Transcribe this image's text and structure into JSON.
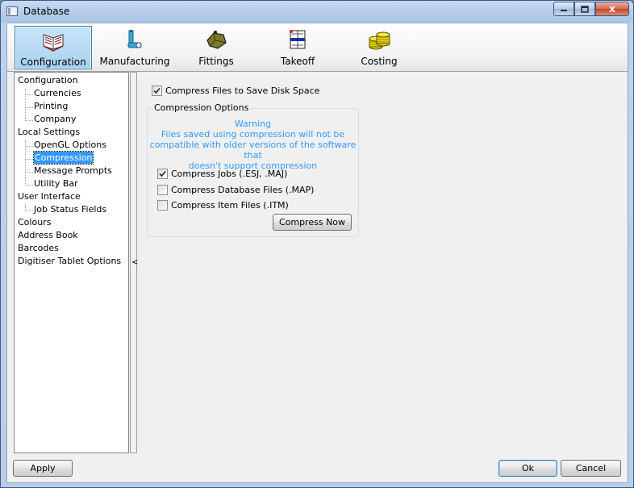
{
  "window": {
    "title": "Database",
    "close_glyph": "x"
  },
  "toolbar": {
    "items": [
      {
        "label": "Configuration",
        "icon": "books-icon",
        "active": true
      },
      {
        "label": "Manufacturing",
        "icon": "machine-icon",
        "active": false
      },
      {
        "label": "Fittings",
        "icon": "fitting-icon",
        "active": false
      },
      {
        "label": "Takeoff",
        "icon": "takeoff-icon",
        "active": false
      },
      {
        "label": "Costing",
        "icon": "coins-icon",
        "active": false
      }
    ]
  },
  "tree": {
    "items": [
      {
        "label": "Configuration",
        "level": 0
      },
      {
        "label": "Currencies",
        "level": 1
      },
      {
        "label": "Printing",
        "level": 1
      },
      {
        "label": "Company",
        "level": 1
      },
      {
        "label": "Local Settings",
        "level": 0
      },
      {
        "label": "OpenGL Options",
        "level": 1
      },
      {
        "label": "Compression",
        "level": 1,
        "selected": true
      },
      {
        "label": "Message Prompts",
        "level": 1
      },
      {
        "label": "Utility Bar",
        "level": 1
      },
      {
        "label": "User Interface",
        "level": 0
      },
      {
        "label": "Job Status Fields",
        "level": 1
      },
      {
        "label": "Colours",
        "level": 0
      },
      {
        "label": "Address Book",
        "level": 0
      },
      {
        "label": "Barcodes",
        "level": 0
      },
      {
        "label": "Digitiser Tablet Options",
        "level": 0
      }
    ]
  },
  "splitter": {
    "arrow": "<"
  },
  "compression": {
    "compress_files": {
      "label": "Compress Files to Save Disk Space",
      "checked": true
    },
    "group_title": "Compression Options",
    "warning_title": "Warning",
    "warning_lines": [
      "Files saved using compression will not be",
      "compatible with older versions of the software that",
      "doesn't support compression"
    ],
    "options": [
      {
        "label": "Compress Jobs (.ESJ, .MAJ)",
        "checked": true
      },
      {
        "label": "Compress Database Files (.MAP)",
        "checked": false
      },
      {
        "label": "Compress Item Files (.ITM)",
        "checked": false
      }
    ],
    "compress_now_label": "Compress Now"
  },
  "footer": {
    "apply_label": "Apply",
    "ok_label": "Ok",
    "cancel_label": "Cancel"
  },
  "colors": {
    "accent": "#3399ff",
    "warning_text": "#3399ff"
  }
}
